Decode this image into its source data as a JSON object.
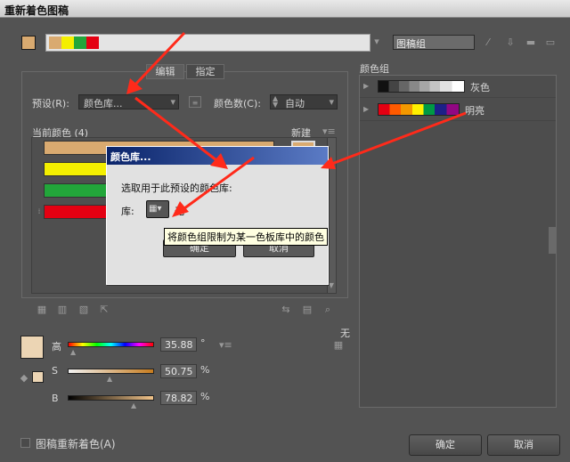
{
  "window": {
    "title": "重新着色图稿"
  },
  "top": {
    "group_name_value": "图稿组"
  },
  "tabs": {
    "edit": "编辑",
    "assign": "指定"
  },
  "preset": {
    "label": "预设(R):",
    "value": "颜色库..."
  },
  "colors_count": {
    "label": "颜色数(C):",
    "value": "自动"
  },
  "current_colors": {
    "label": "当前颜色 (4)",
    "new_label": "新建"
  },
  "color_groups": {
    "title": "颜色组",
    "items": [
      {
        "label": "灰色"
      },
      {
        "label": "明亮"
      }
    ]
  },
  "sliders": {
    "h": {
      "label": "高",
      "value": "35.88",
      "unit": "°"
    },
    "s": {
      "label": "S",
      "value": "50.75",
      "unit": "%"
    },
    "b": {
      "label": "B",
      "value": "78.82",
      "unit": "%"
    }
  },
  "none_label": "无",
  "recolor_checkbox": {
    "label": "图稿重新着色(A)"
  },
  "buttons": {
    "ok": "确定",
    "cancel": "取消"
  },
  "modal": {
    "title": "颜色库...",
    "prompt": "选取用于此预设的颜色库:",
    "lib_label": "库:",
    "lib_value": "无",
    "tooltip": "将颜色组限制为某一色板库中的颜色",
    "ok": "确定",
    "cancel": "取消"
  },
  "colors": {
    "tan": "#d9aa70",
    "yellow": "#f4ef00",
    "green": "#22a63a",
    "red": "#e40012",
    "arrow": "#ff2a1a"
  }
}
